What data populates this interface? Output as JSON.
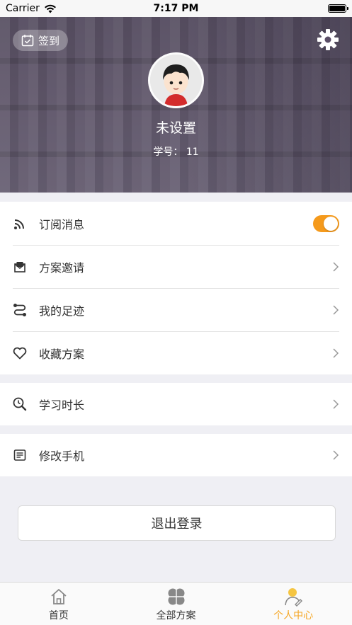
{
  "status_bar": {
    "carrier": "Carrier",
    "time": "7:17 PM"
  },
  "header": {
    "checkin_label": "签到",
    "nickname": "未设置",
    "student_id_label": "学号：",
    "student_id": "11"
  },
  "menu_groups": [
    [
      {
        "label": "订阅消息",
        "icon": "rss-icon",
        "control": "toggle",
        "on": true
      },
      {
        "label": "方案邀请",
        "icon": "envelope-icon",
        "control": "chevron"
      },
      {
        "label": "我的足迹",
        "icon": "route-icon",
        "control": "chevron"
      },
      {
        "label": "收藏方案",
        "icon": "heart-icon",
        "control": "chevron"
      }
    ],
    [
      {
        "label": "学习时长",
        "icon": "magnifier-clock-icon",
        "control": "chevron"
      }
    ],
    [
      {
        "label": "修改手机",
        "icon": "phone-doc-icon",
        "control": "chevron"
      }
    ]
  ],
  "logout_label": "退出登录",
  "tabs": [
    {
      "label": "首页",
      "icon": "home-icon",
      "active": false
    },
    {
      "label": "全部方案",
      "icon": "clover-icon",
      "active": false
    },
    {
      "label": "个人中心",
      "icon": "person-icon",
      "active": true
    }
  ],
  "colors": {
    "accent": "#f59a1c",
    "tab_active": "#f5a623",
    "background": "#efeff4"
  }
}
